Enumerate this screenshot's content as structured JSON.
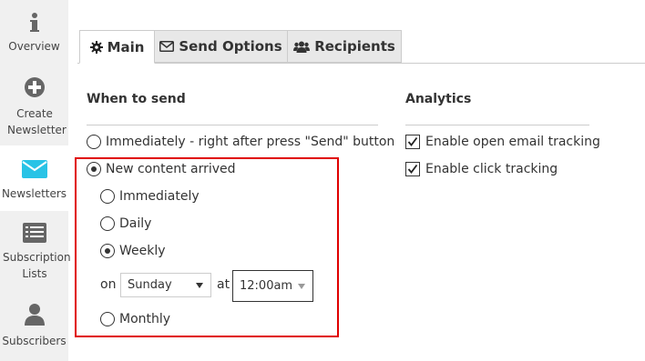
{
  "sidebar": {
    "items": [
      {
        "label": "Overview",
        "icon": "info-icon"
      },
      {
        "label": "Create Newsletter",
        "icon": "plus-circle-icon"
      },
      {
        "label": "Newsletters",
        "icon": "envelope-icon",
        "active": true
      },
      {
        "label": "Subscription Lists",
        "icon": "list-icon"
      },
      {
        "label": "Subscribers",
        "icon": "user-icon"
      }
    ]
  },
  "tabs": [
    {
      "label": "Main",
      "icon": "gear-icon",
      "active": true
    },
    {
      "label": "Send Options",
      "icon": "envelope-outline-icon"
    },
    {
      "label": "Recipients",
      "icon": "users-icon"
    }
  ],
  "when_to_send": {
    "heading": "When to send",
    "option_immediately": "Immediately - right after press \"Send\" button",
    "option_new_content": "New content arrived",
    "sub_immediately": "Immediately",
    "sub_daily": "Daily",
    "sub_weekly": "Weekly",
    "sub_monthly": "Monthly",
    "on_label": "on",
    "day_value": "Sunday",
    "at_label": "at",
    "time_value": "12:00am"
  },
  "analytics": {
    "heading": "Analytics",
    "open_tracking": "Enable open email tracking",
    "click_tracking": "Enable click tracking"
  },
  "colors": {
    "accent": "#29c3e6",
    "highlight_border": "#e00000",
    "sidebar_bg": "#f0f0f0"
  }
}
